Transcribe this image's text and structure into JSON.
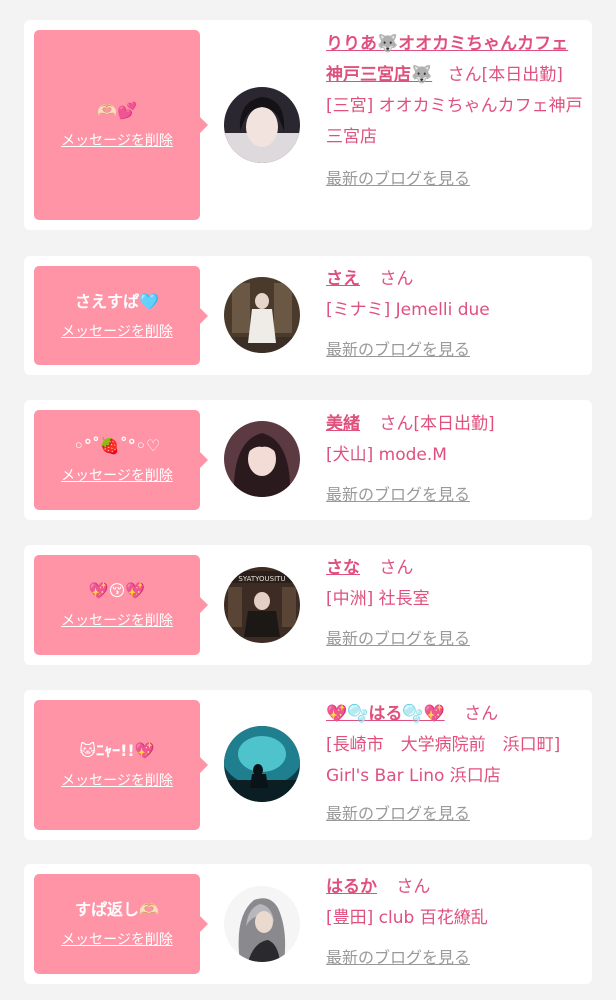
{
  "colors": {
    "accent": "#ff94a7",
    "name": "#e0507e",
    "muted": "#999999",
    "background": "#f3f3f3"
  },
  "delete_label": "メッセージを削除",
  "blog_label": "最新のブログを見る",
  "honorific": "さん",
  "items": [
    {
      "message": "🫶🏻💕",
      "name": "りりあ🐺オオカミちゃんカフェ神戸三宮店🐺",
      "status": "[本日出勤]",
      "shop": "[三宮] オオカミちゃんカフェ神戸三宮店"
    },
    {
      "message": "さえすぱ🩵",
      "name": "さえ",
      "status": "",
      "shop": "[ミナミ] Jemelli due"
    },
    {
      "message": "◦°˚🍓˚°◦♡",
      "name": "美緒",
      "status": "[本日出勤]",
      "shop": "[犬山] mode.M"
    },
    {
      "message": "💖😚💖",
      "name": "さな",
      "status": "",
      "shop": "[中洲] 社長室"
    },
    {
      "message": "🐱ﾆｬｰ!!💖",
      "name": "💖🫧はる🫧💖",
      "status": "",
      "shop": "[長崎市　大学病院前　浜口町] Girl's Bar Lino 浜口店"
    },
    {
      "message": "すぱ返し🫶🏻",
      "name": "はるか",
      "status": "",
      "shop": "[豊田] club 百花繚乱"
    }
  ]
}
